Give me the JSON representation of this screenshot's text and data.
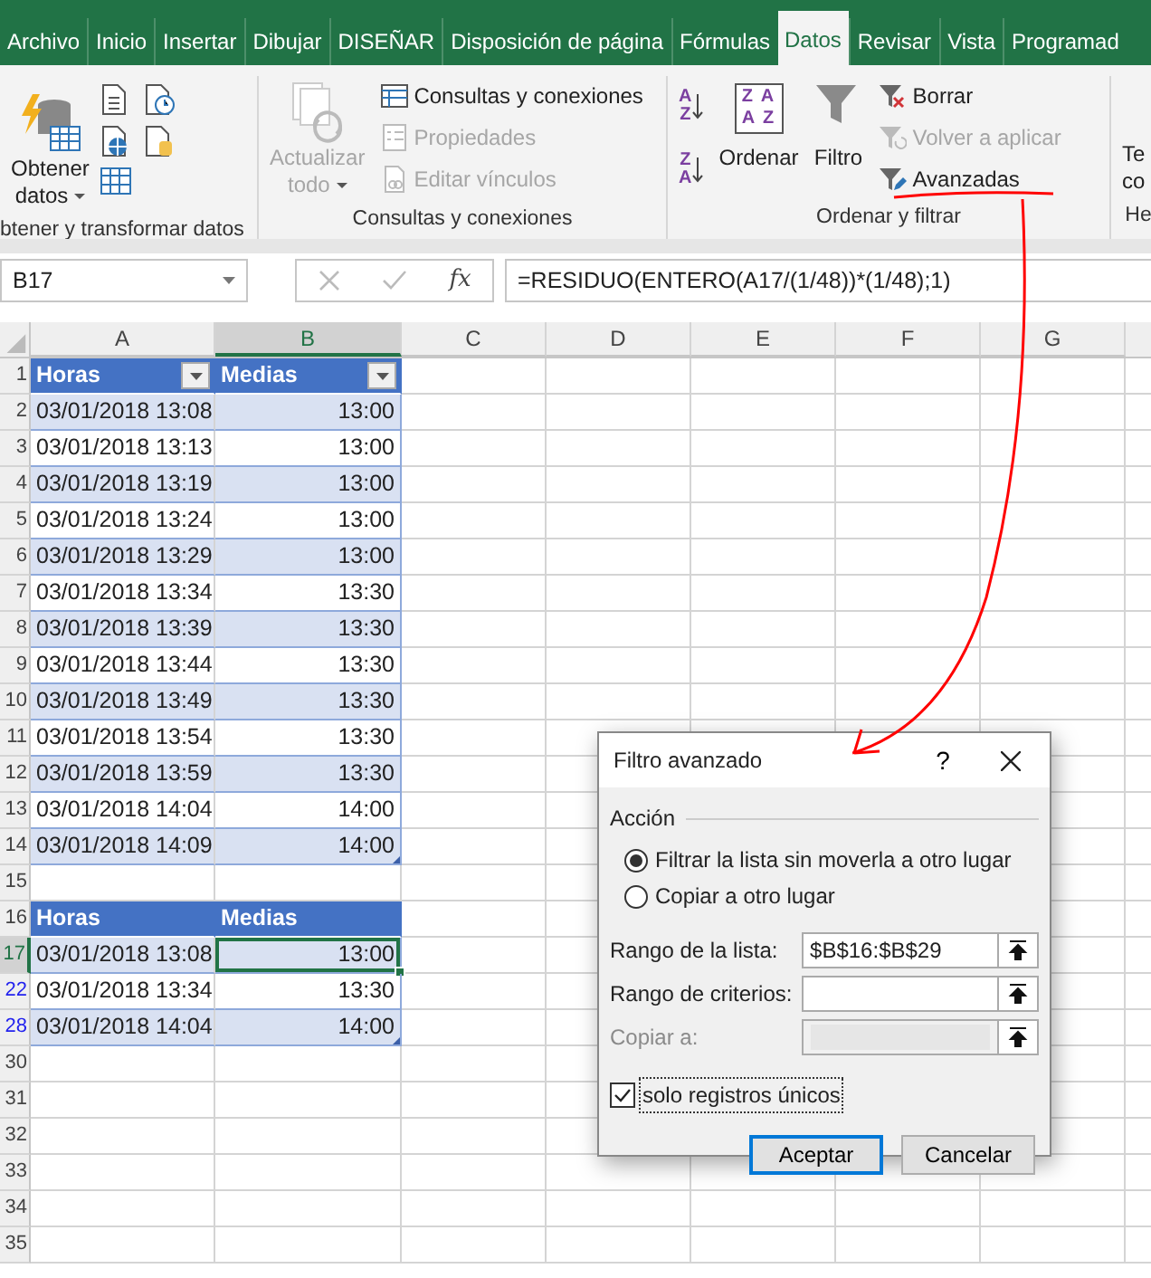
{
  "ribbon": {
    "tabs": [
      {
        "label": "Archivo",
        "selected": false
      },
      {
        "label": "Inicio",
        "selected": false
      },
      {
        "label": "Insertar",
        "selected": false
      },
      {
        "label": "Dibujar",
        "selected": false
      },
      {
        "label": "DISEÑAR",
        "selected": false
      },
      {
        "label": "Disposición de página",
        "selected": false
      },
      {
        "label": "Fórmulas",
        "selected": false
      },
      {
        "label": "Datos",
        "selected": true
      },
      {
        "label": "Revisar",
        "selected": false
      },
      {
        "label": "Vista",
        "selected": false
      },
      {
        "label": "Programad",
        "selected": false
      }
    ],
    "groups": [
      {
        "label": "btener y transformar datos",
        "items": [
          {
            "kind": "large",
            "lines": [
              "Obtener",
              "datos"
            ],
            "dropdown": true,
            "disabled": false
          },
          {
            "kind": "icons"
          }
        ]
      },
      {
        "label": "Consultas y conexiones",
        "items": [
          {
            "kind": "large",
            "lines": [
              "Actualizar",
              "todo"
            ],
            "dropdown": true,
            "disabled": true
          },
          {
            "kind": "small",
            "label": "Consultas y conexiones",
            "disabled": false
          },
          {
            "kind": "small",
            "label": "Propiedades",
            "disabled": true
          },
          {
            "kind": "small",
            "label": "Editar vínculos",
            "disabled": true
          }
        ]
      },
      {
        "label": "Ordenar y filtrar",
        "items": [
          {
            "kind": "sort",
            "letters": [
              "A",
              "Z"
            ]
          },
          {
            "kind": "sort",
            "letters": [
              "Z",
              "A"
            ]
          },
          {
            "kind": "sortbox",
            "icon_lines": [
              "Z A",
              "A Z"
            ],
            "lines": [
              "Ordenar"
            ],
            "dropdown": false,
            "disabled": false
          },
          {
            "kind": "large",
            "lines": [
              "Filtro"
            ],
            "dropdown": false,
            "disabled": false
          },
          {
            "kind": "small",
            "label": "Borrar",
            "disabled": false
          },
          {
            "kind": "small",
            "label": "Volver a aplicar",
            "disabled": true
          },
          {
            "kind": "small",
            "label": "Avanzadas",
            "disabled": false
          }
        ]
      },
      {
        "label": "He",
        "items": [
          {
            "kind": "cut",
            "lines": [
              "Te",
              "co"
            ]
          }
        ]
      }
    ]
  },
  "formula_bar": {
    "name_box": "B17",
    "function_button": "fx",
    "formula": "=RESIDUO(ENTERO(A17/(1/48))*(1/48);1)"
  },
  "sheet": {
    "columns": [
      {
        "label": "A",
        "selected": false
      },
      {
        "label": "B",
        "selected": true
      },
      {
        "label": "C",
        "selected": false
      },
      {
        "label": "D",
        "selected": false
      },
      {
        "label": "E",
        "selected": false
      },
      {
        "label": "F",
        "selected": false
      },
      {
        "label": "G",
        "selected": false
      }
    ],
    "rows": [
      {
        "number": "1",
        "kind": "header",
        "filter_buttons": true,
        "filtered": false,
        "selected": false,
        "cells": [
          {
            "text": "Horas",
            "selected": false
          },
          {
            "text": "Medias",
            "selected": false
          }
        ]
      },
      {
        "number": "2",
        "kind": "data",
        "band": true,
        "filtered": false,
        "selected": false,
        "table_end": false,
        "cells": [
          {
            "text": "03/01/2018 13:08",
            "selected": false
          },
          {
            "text": "13:00",
            "selected": false
          }
        ]
      },
      {
        "number": "3",
        "kind": "data",
        "band": false,
        "filtered": false,
        "selected": false,
        "table_end": false,
        "cells": [
          {
            "text": "03/01/2018 13:13",
            "selected": false
          },
          {
            "text": "13:00",
            "selected": false
          }
        ]
      },
      {
        "number": "4",
        "kind": "data",
        "band": true,
        "filtered": false,
        "selected": false,
        "table_end": false,
        "cells": [
          {
            "text": "03/01/2018 13:19",
            "selected": false
          },
          {
            "text": "13:00",
            "selected": false
          }
        ]
      },
      {
        "number": "5",
        "kind": "data",
        "band": false,
        "filtered": false,
        "selected": false,
        "table_end": false,
        "cells": [
          {
            "text": "03/01/2018 13:24",
            "selected": false
          },
          {
            "text": "13:00",
            "selected": false
          }
        ]
      },
      {
        "number": "6",
        "kind": "data",
        "band": true,
        "filtered": false,
        "selected": false,
        "table_end": false,
        "cells": [
          {
            "text": "03/01/2018 13:29",
            "selected": false
          },
          {
            "text": "13:00",
            "selected": false
          }
        ]
      },
      {
        "number": "7",
        "kind": "data",
        "band": false,
        "filtered": false,
        "selected": false,
        "table_end": false,
        "cells": [
          {
            "text": "03/01/2018 13:34",
            "selected": false
          },
          {
            "text": "13:30",
            "selected": false
          }
        ]
      },
      {
        "number": "8",
        "kind": "data",
        "band": true,
        "filtered": false,
        "selected": false,
        "table_end": false,
        "cells": [
          {
            "text": "03/01/2018 13:39",
            "selected": false
          },
          {
            "text": "13:30",
            "selected": false
          }
        ]
      },
      {
        "number": "9",
        "kind": "data",
        "band": false,
        "filtered": false,
        "selected": false,
        "table_end": false,
        "cells": [
          {
            "text": "03/01/2018 13:44",
            "selected": false
          },
          {
            "text": "13:30",
            "selected": false
          }
        ]
      },
      {
        "number": "10",
        "kind": "data",
        "band": true,
        "filtered": false,
        "selected": false,
        "table_end": false,
        "cells": [
          {
            "text": "03/01/2018 13:49",
            "selected": false
          },
          {
            "text": "13:30",
            "selected": false
          }
        ]
      },
      {
        "number": "11",
        "kind": "data",
        "band": false,
        "filtered": false,
        "selected": false,
        "table_end": false,
        "cells": [
          {
            "text": "03/01/2018 13:54",
            "selected": false
          },
          {
            "text": "13:30",
            "selected": false
          }
        ]
      },
      {
        "number": "12",
        "kind": "data",
        "band": true,
        "filtered": false,
        "selected": false,
        "table_end": false,
        "cells": [
          {
            "text": "03/01/2018 13:59",
            "selected": false
          },
          {
            "text": "13:30",
            "selected": false
          }
        ]
      },
      {
        "number": "13",
        "kind": "data",
        "band": false,
        "filtered": false,
        "selected": false,
        "table_end": false,
        "cells": [
          {
            "text": "03/01/2018 14:04",
            "selected": false
          },
          {
            "text": "14:00",
            "selected": false
          }
        ]
      },
      {
        "number": "14",
        "kind": "data",
        "band": true,
        "filtered": false,
        "selected": false,
        "table_end": true,
        "cells": [
          {
            "text": "03/01/2018 14:09",
            "selected": false
          },
          {
            "text": "14:00",
            "selected": false
          }
        ]
      },
      {
        "number": "15",
        "kind": "empty",
        "filtered": false,
        "selected": false
      },
      {
        "number": "16",
        "kind": "header",
        "filter_buttons": false,
        "filtered": false,
        "selected": false,
        "cells": [
          {
            "text": "Horas",
            "selected": false
          },
          {
            "text": "Medias",
            "selected": false
          }
        ]
      },
      {
        "number": "17",
        "kind": "data",
        "band": true,
        "filtered": true,
        "selected": true,
        "table_end": false,
        "cells": [
          {
            "text": "03/01/2018 13:08",
            "selected": false
          },
          {
            "text": "13:00",
            "selected": true
          }
        ]
      },
      {
        "number": "22",
        "kind": "data",
        "band": false,
        "filtered": true,
        "selected": false,
        "table_end": false,
        "cells": [
          {
            "text": "03/01/2018 13:34",
            "selected": false
          },
          {
            "text": "13:30",
            "selected": false
          }
        ]
      },
      {
        "number": "28",
        "kind": "data",
        "band": true,
        "filtered": true,
        "selected": false,
        "table_end": true,
        "cells": [
          {
            "text": "03/01/2018 14:04",
            "selected": false
          },
          {
            "text": "14:00",
            "selected": false
          }
        ]
      },
      {
        "number": "30",
        "kind": "empty",
        "filtered": false,
        "selected": false
      },
      {
        "number": "31",
        "kind": "empty",
        "filtered": false,
        "selected": false
      },
      {
        "number": "32",
        "kind": "empty",
        "filtered": false,
        "selected": false
      },
      {
        "number": "33",
        "kind": "empty",
        "filtered": false,
        "selected": false
      },
      {
        "number": "34",
        "kind": "empty",
        "filtered": false,
        "selected": false
      },
      {
        "number": "35",
        "kind": "empty",
        "filtered": false,
        "selected": false
      }
    ]
  },
  "dialog": {
    "title": "Filtro avanzado",
    "help": "?",
    "section": "Acción",
    "radios": [
      {
        "label": "Filtrar la lista sin moverla a otro lugar",
        "selected": true
      },
      {
        "label": "Copiar a otro lugar",
        "selected": false
      }
    ],
    "fields": [
      {
        "label": "Rango de la lista:",
        "value": "$B$16:$B$29",
        "disabled": false
      },
      {
        "label": "Rango de criterios:",
        "disabled": false
      },
      {
        "label": "Copiar a:",
        "disabled": true
      }
    ],
    "checkbox": {
      "label": "solo registros únicos",
      "checked": true
    },
    "buttons": [
      {
        "label": "Aceptar",
        "default": true
      },
      {
        "label": "Cancelar",
        "default": false
      }
    ]
  }
}
